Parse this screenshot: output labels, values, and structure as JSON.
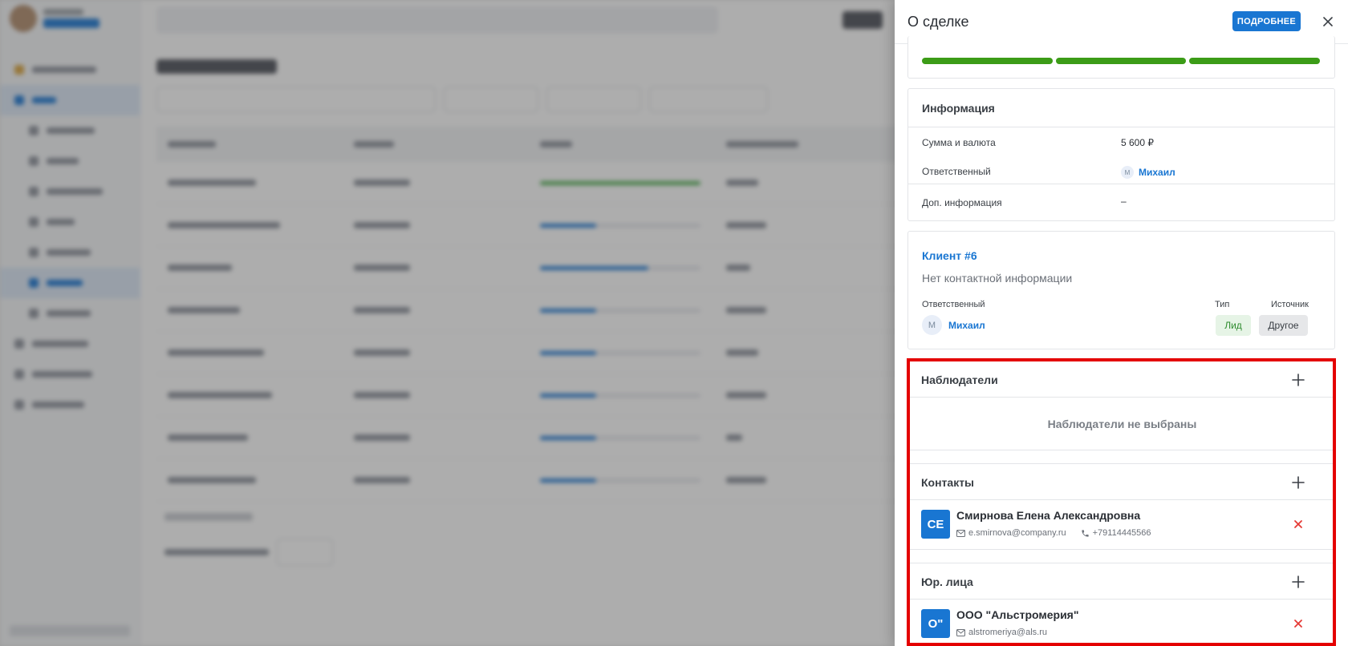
{
  "drawer": {
    "title": "О сделке",
    "more_label": "ПОДРОБНЕЕ",
    "close_icon": "close-icon"
  },
  "stage_progress": {
    "segments_filled": 3,
    "segments_total": 3,
    "color": "#3c9c17"
  },
  "info": {
    "title": "Информация",
    "rows": [
      {
        "label": "Сумма и валюта",
        "value": "5 600 ₽"
      },
      {
        "label": "Ответственный",
        "value": "Михаил",
        "avatar": "М"
      },
      {
        "label": "Доп. информация",
        "value": "–"
      }
    ]
  },
  "client": {
    "name": "Клиент #6",
    "subtitle": "Нет контактной информации",
    "responsible_label": "Ответственный",
    "responsible_name": "Михаил",
    "responsible_avatar": "М",
    "type_label": "Тип",
    "type_value": "Лид",
    "source_label": "Источник",
    "source_value": "Другое"
  },
  "observers": {
    "title": "Наблюдатели",
    "empty_text": "Наблюдатели не выбраны"
  },
  "contacts": {
    "title": "Контакты",
    "items": [
      {
        "initials": "СЕ",
        "name": "Смирнова Елена Александровна",
        "email": "e.smirnova@company.ru",
        "phone": "+79114445566"
      }
    ]
  },
  "legal": {
    "title": "Юр. лица",
    "items": [
      {
        "initials": "О\"",
        "name": "ООО \"Альстромерия\"",
        "email": "alstromeriya@als.ru"
      }
    ]
  },
  "colors": {
    "accent": "#1976d2",
    "remove": "#e53935",
    "highlight": "#e40000",
    "lead_chip_bg": "#e6f4e6",
    "lead_chip_text": "#2e8b2e"
  }
}
